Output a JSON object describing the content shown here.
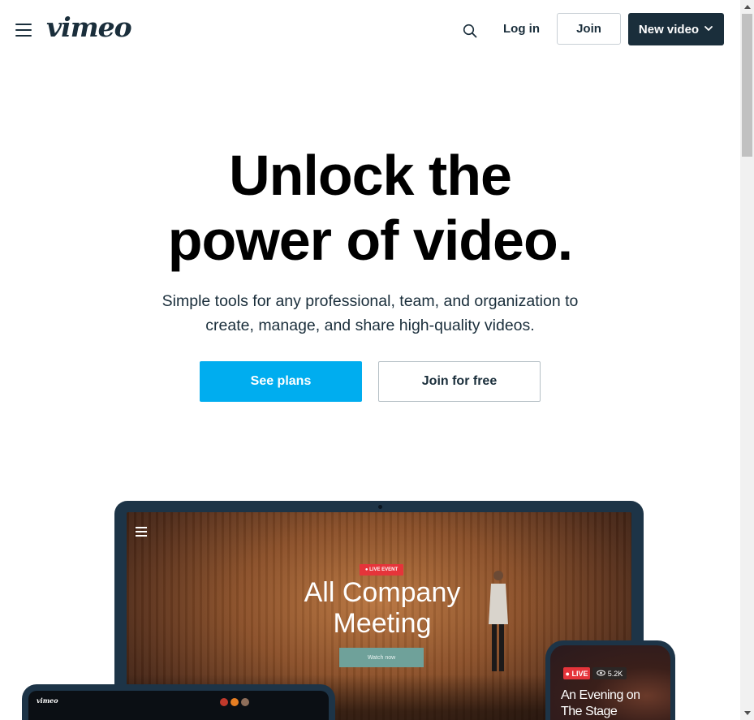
{
  "header": {
    "logo": "vimeo",
    "login_label": "Log in",
    "join_label": "Join",
    "new_video_label": "New video"
  },
  "hero": {
    "title_line1": "Unlock the",
    "title_line2": "power of video.",
    "subtitle": "Simple tools for any professional, team, and organization to create, manage, and share high-quality videos.",
    "primary_cta": "See plans",
    "secondary_cta": "Join for free"
  },
  "mockup": {
    "laptop": {
      "badge": "● LIVE EVENT",
      "title_line1": "All Company",
      "title_line2": "Meeting",
      "watch_label": "Watch now"
    },
    "tablet": {
      "logo": "vimeo"
    },
    "phone": {
      "live_label": "● LIVE",
      "viewers": "5.2K",
      "title_line1": "An Evening on",
      "title_line2": "The Stage"
    }
  },
  "icons": {
    "menu": "hamburger-menu-icon",
    "search": "search-icon",
    "chevron": "chevron-down-icon",
    "eye": "eye-icon"
  },
  "colors": {
    "brand_dark": "#1a2e3b",
    "accent_blue": "#00adef",
    "live_red": "#e5343a"
  }
}
